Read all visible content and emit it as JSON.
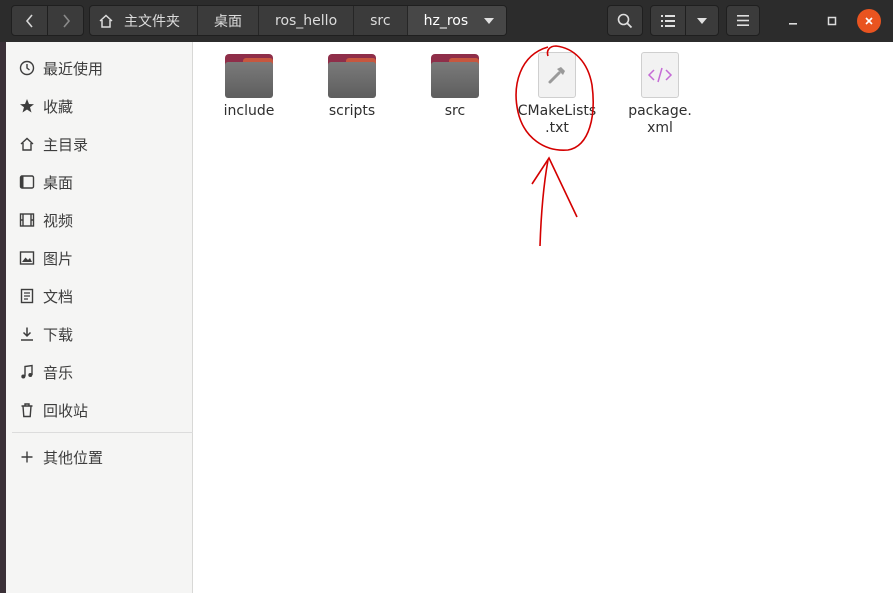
{
  "breadcrumb": [
    "主文件夹",
    "桌面",
    "ros_hello",
    "src",
    "hz_ros"
  ],
  "sidebar": {
    "items": [
      {
        "label": "最近使用",
        "icon": "clock-icon"
      },
      {
        "label": "收藏",
        "icon": "star-icon"
      },
      {
        "label": "主目录",
        "icon": "home-icon"
      },
      {
        "label": "桌面",
        "icon": "desktop-icon"
      },
      {
        "label": "视频",
        "icon": "video-icon"
      },
      {
        "label": "图片",
        "icon": "image-icon"
      },
      {
        "label": "文档",
        "icon": "document-icon"
      },
      {
        "label": "下载",
        "icon": "download-icon"
      },
      {
        "label": "音乐",
        "icon": "music-icon"
      },
      {
        "label": "回收站",
        "icon": "trash-icon"
      }
    ],
    "other": {
      "label": "其他位置",
      "icon": "plus-icon"
    }
  },
  "files": [
    {
      "name": "include",
      "type": "folder"
    },
    {
      "name": "scripts",
      "type": "folder"
    },
    {
      "name": "src",
      "type": "folder"
    },
    {
      "name": "CMakeLists.txt",
      "line1": "CMakeLists",
      "line2": ".txt",
      "type": "text-file",
      "icon": "hammer-icon"
    },
    {
      "name": "package.xml",
      "line1": "package.",
      "line2": "xml",
      "type": "xml-file",
      "icon": "code-icon"
    }
  ],
  "colors": {
    "headerbar": "#2c2c2c",
    "accent_close": "#e95420",
    "folder_tab": "#8f2e49",
    "annotation": "#d40000"
  }
}
